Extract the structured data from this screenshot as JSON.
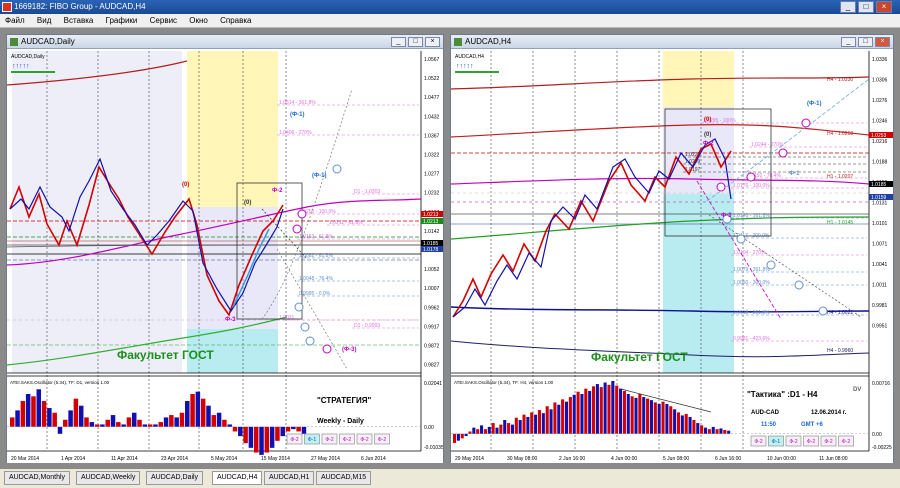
{
  "app": {
    "title": "1669182: FIBO Group - AUDCAD,H4"
  },
  "menu": [
    "Файл",
    "Вид",
    "Вставка",
    "Графики",
    "Сервис",
    "Окно",
    "Справка"
  ],
  "colors": {
    "bull": "#d40000",
    "bear": "#1010b0",
    "ma_magenta": "#c000c0",
    "ma_green": "#30a030",
    "fibo_pink": "#e070e0",
    "fibo_blue": "#6090d0",
    "zone_yellow": "#fff6b8",
    "zone_cyan": "#b8ecf0",
    "zone_lavender": "#e8e8f8",
    "label_red": "#d00000",
    "label_green": "#1a8f1a"
  },
  "daily": {
    "window_title": "AUDCAD,Daily",
    "chart_label": "AUDCAD,Daily",
    "arrows": "↑↑↑↑↑",
    "watermark": "Факультет ГОСТ",
    "price_axis": [
      "1.0567",
      "1.0522",
      "1.0477",
      "1.0432",
      "1.0367",
      "1.0322",
      "1.0277",
      "1.0232",
      "1.0187",
      "1.0142",
      "1.0097",
      "1.0052",
      "1.0007",
      "0.9962",
      "0.9917",
      "0.9872",
      "0.9827"
    ],
    "price_tags": [
      "1.0213",
      "1.0213",
      "1.0185",
      "1.0178"
    ],
    "fibo_labels": [
      "1.0514 - 361.8%",
      "1.0406 - 270%",
      "1.0250 - 100.0%",
      "1.0211 - 61.8%",
      "1.0163 - 61.8%",
      "1.0082 - 61.8%",
      "1.0048 - 76.4%",
      "0.9995 - 0.0%",
      "1.0031",
      "D1 - 1.0303",
      "D1 - 0.9993"
    ],
    "phi_labels": [
      "(Ф-1)",
      "(Ф-1)",
      "Ф-2",
      "(0)",
      "(0)",
      "Ф-3",
      "(Ф-3)"
    ],
    "osc_title": "ATEI.SAKS.Oscillator (5.34), TF: D1, version 1.00",
    "osc_axis": [
      "0.02041",
      "0.00",
      "-0.01035"
    ],
    "osc_values": [
      0.004,
      0.007,
      0.011,
      0.014,
      0.013,
      0.016,
      0.011,
      0.008,
      0.006,
      -0.003,
      0.003,
      0.007,
      0.012,
      0.009,
      0.004,
      0.002,
      0.001,
      0.001,
      0.003,
      0.005,
      0.002,
      0.001,
      0.004,
      0.006,
      0.003,
      0.001,
      0.001,
      0.001,
      0.002,
      0.004,
      0.005,
      0.004,
      0.006,
      0.011,
      0.014,
      0.015,
      0.012,
      0.009,
      0.005,
      0.006,
      0.003,
      0.001,
      -0.002,
      -0.004,
      -0.007,
      -0.009,
      -0.011,
      -0.012,
      -0.011,
      -0.009,
      -0.006,
      -0.004,
      -0.002,
      -0.001,
      -0.002,
      -0.003
    ],
    "strategy": "\"СТРАТЕГИЯ\"",
    "strategy_sub": "Weekly - Daily",
    "phi_buttons": [
      "Ф-2",
      "Ф-1",
      "Ф-2",
      "Ф-2",
      "Ф-2",
      "Ф-2"
    ],
    "time_axis": [
      "20 Mar 2014",
      "1 Apr 2014",
      "11 Apr 2014",
      "23 Apr 2014",
      "5 May 2014",
      "15 May 2014",
      "27 May 2014",
      "6 Jun 2014"
    ]
  },
  "h4": {
    "window_title": "AUDCAD,H4",
    "chart_label": "AUDCAD,H4",
    "arrows": "↑↑↑↑↑",
    "watermark": "Факультет ГОСТ",
    "price_axis": [
      "1.0336",
      "1.0306",
      "1.0276",
      "1.0246",
      "1.0216",
      "1.0188",
      "1.0159",
      "1.0131",
      "1.0101",
      "1.0071",
      "1.0041",
      "1.0011",
      "0.9981",
      "0.9951"
    ],
    "price_tags": [
      "1.0253",
      "1.0185",
      "1.0159"
    ],
    "level_labels": [
      "H4 - 1.0330",
      "H4 - 1.0268",
      "H1 - 1.0207",
      "H1 - 1.0145",
      "H4 - 1.0022",
      "H4 - 0.9960"
    ],
    "fibo_labels": [
      "1.0295 - 100%",
      "1.0244 - 270%",
      "1.0225",
      "1.0209",
      "1.0197",
      "1.0192 - 78.4%",
      "1.0176 - 100.0%",
      "1.0140 - 161.8%",
      "1.0117 - 200.0%",
      "1.0104 - 270%",
      "1.0079 - 261.8%",
      "1.0050 - 300.0%",
      "1.0018 - 361.8%",
      "0.9981 - 423.6%"
    ],
    "phi_labels": [
      "(Ф-1)",
      "Ф-1",
      "Ф-2",
      "Ф-3",
      "(0)",
      "(0)"
    ],
    "osc_title": "ATEI.SAKS.Oscillator (5.34), TF: H4, version 1.00",
    "osc_axis": [
      "0.00716",
      "0.00",
      "-0.00225"
    ],
    "osc_values": [
      -0.0012,
      -0.0009,
      -0.0006,
      -0.0003,
      0.0003,
      0.0008,
      0.0006,
      0.0011,
      0.0006,
      0.0009,
      0.0014,
      0.0008,
      0.0012,
      0.0018,
      0.0014,
      0.0012,
      0.0021,
      0.0018,
      0.0025,
      0.0022,
      0.0028,
      0.0025,
      0.0031,
      0.0027,
      0.0036,
      0.0032,
      0.0041,
      0.0038,
      0.0045,
      0.0042,
      0.0048,
      0.0051,
      0.0055,
      0.0052,
      0.0059,
      0.0056,
      0.0062,
      0.0065,
      0.0061,
      0.0067,
      0.0064,
      0.0069,
      0.0063,
      0.0059,
      0.0056,
      0.0052,
      0.0049,
      0.0047,
      0.0052,
      0.0048,
      0.0046,
      0.0044,
      0.0041,
      0.0039,
      0.0042,
      0.0039,
      0.0036,
      0.0032,
      0.0028,
      0.0024,
      0.0026,
      0.0022,
      0.0018,
      0.0014,
      0.0011,
      0.0008,
      0.0006,
      0.0009,
      0.0006,
      0.0007,
      0.0005,
      0.0004
    ],
    "tactic": "\"Тактика\" :D1 - H4",
    "pair": "AUD-CAD",
    "date": "12.06.2014 г.",
    "time": "11:50",
    "gmt": "GMT +6",
    "dv": "DV",
    "phi_buttons": [
      "Ф-2",
      "Ф-1",
      "Ф-2",
      "Ф-2",
      "Ф-2",
      "Ф-2"
    ],
    "time_axis": [
      "29 May 2014",
      "30 May 08:00",
      "2 Jun 16:00",
      "4 Jun 00:00",
      "5 Jun 08:00",
      "6 Jun 16:00",
      "10 Jun 00:00",
      "11 Jun 08:00"
    ]
  },
  "tabs": [
    "AUDCAD,Monthly",
    "AUDCAD,Weekly",
    "AUDCAD,Daily",
    "AUDCAD,H4",
    "AUDCAD,H1",
    "AUDCAD,M15"
  ],
  "active_tab": "AUDCAD,H4"
}
